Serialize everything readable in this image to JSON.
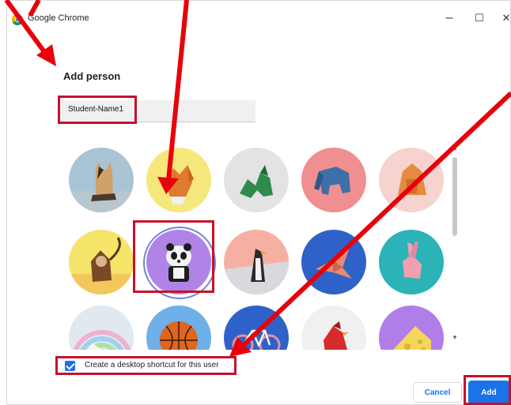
{
  "window": {
    "app_title": "Google Chrome",
    "minimize_glyph": "–",
    "maximize_glyph": "☐",
    "close_glyph": "✕"
  },
  "dialog": {
    "heading": "Add person",
    "name_value": "Student-Name1",
    "selected_avatar": "panda",
    "avatars": [
      "cat",
      "fox",
      "dragon",
      "elephant",
      "fox-house",
      "monkey",
      "panda",
      "penguin",
      "bird",
      "rabbit",
      "rainbow",
      "basketball",
      "bicycle",
      "cardinal",
      "cheese"
    ],
    "shortcut_checked": true,
    "shortcut_label": "Create a desktop shortcut for this user",
    "cancel_label": "Cancel",
    "add_label": "Add"
  },
  "colors": {
    "accent": "#1a73e8",
    "annotation": "#e8000b"
  }
}
